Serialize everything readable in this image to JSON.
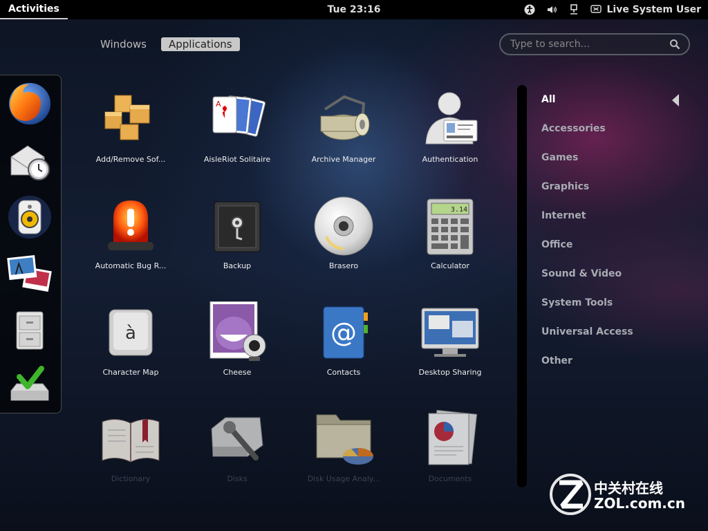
{
  "topbar": {
    "activities": "Activities",
    "clock": "Tue 23:16",
    "user": "Live System User",
    "icons": [
      "accessibility-icon",
      "volume-icon",
      "network-icon",
      "user-status-icon"
    ]
  },
  "view_tabs": [
    {
      "label": "Windows",
      "active": false
    },
    {
      "label": "Applications",
      "active": true
    }
  ],
  "search": {
    "placeholder": "Type to search..."
  },
  "dash": [
    "firefox",
    "evolution",
    "rhythmbox",
    "shotwell",
    "file-manager",
    "installer"
  ],
  "apps": [
    {
      "label": "Add/Remove Sof...",
      "icon": "package-box-icon"
    },
    {
      "label": "AisleRiot Solitaire",
      "icon": "playing-cards-icon"
    },
    {
      "label": "Archive Manager",
      "icon": "archive-roller-icon"
    },
    {
      "label": "Authentication",
      "icon": "id-card-user-icon"
    },
    {
      "label": "Automatic Bug R...",
      "icon": "alarm-light-icon"
    },
    {
      "label": "Backup",
      "icon": "safe-icon"
    },
    {
      "label": "Brasero",
      "icon": "disc-icon"
    },
    {
      "label": "Calculator",
      "icon": "calculator-icon"
    },
    {
      "label": "Character Map",
      "icon": "character-key-icon"
    },
    {
      "label": "Cheese",
      "icon": "webcam-photo-icon"
    },
    {
      "label": "Contacts",
      "icon": "address-book-icon"
    },
    {
      "label": "Desktop Sharing",
      "icon": "monitor-icon"
    },
    {
      "label": "Dictionary",
      "icon": "open-book-icon"
    },
    {
      "label": "Disks",
      "icon": "disk-wrench-icon"
    },
    {
      "label": "Disk Usage Analy...",
      "icon": "folder-chart-icon"
    },
    {
      "label": "Documents",
      "icon": "documents-icon"
    }
  ],
  "calculator_display": "3.14",
  "character_map_glyph": "à",
  "categories": [
    {
      "label": "All",
      "selected": true
    },
    {
      "label": "Accessories",
      "selected": false
    },
    {
      "label": "Games",
      "selected": false
    },
    {
      "label": "Graphics",
      "selected": false
    },
    {
      "label": "Internet",
      "selected": false
    },
    {
      "label": "Office",
      "selected": false
    },
    {
      "label": "Sound & Video",
      "selected": false
    },
    {
      "label": "System Tools",
      "selected": false
    },
    {
      "label": "Universal Access",
      "selected": false
    },
    {
      "label": "Other",
      "selected": false
    }
  ],
  "watermark": {
    "line1": "中关村在线",
    "line2": "ZOL.com.cn"
  },
  "colors": {
    "topbar": "#000000",
    "active_tab": "#c8c8c8",
    "selected_category": "#ffffff",
    "category": "#a8abb3"
  }
}
